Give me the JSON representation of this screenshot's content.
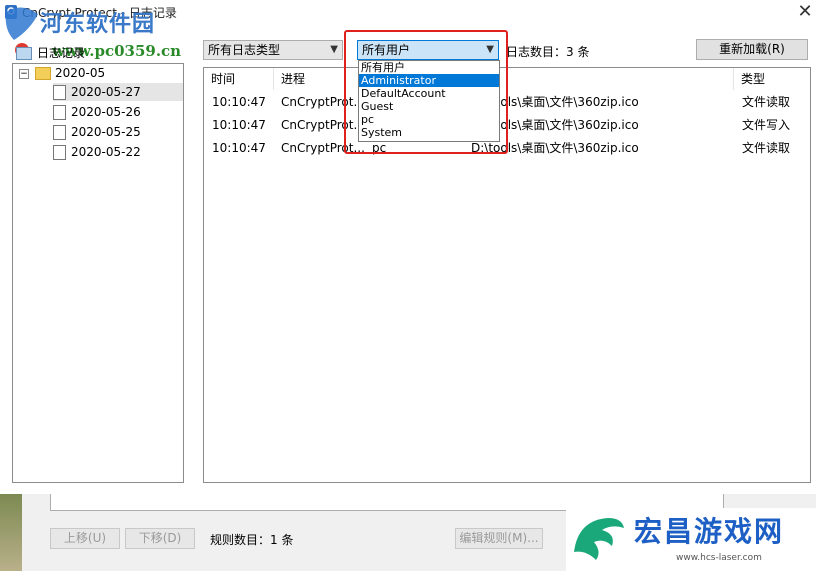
{
  "window": {
    "title": "CnCrypt Protect - 日志记录",
    "close_glyph": "✕"
  },
  "watermark_top": {
    "name": "河东软件园",
    "url": "www.pc0359.cn"
  },
  "tree": {
    "root_label": "日志记录",
    "folder_label": "2020-05",
    "expander": "−",
    "dates": [
      "2020-05-27",
      "2020-05-26",
      "2020-05-25",
      "2020-05-22"
    ],
    "selected_index": 0
  },
  "filters": {
    "log_type_value": "所有日志类型",
    "user_value": "所有用户",
    "count_label": "日志数目：3 条",
    "reload_label": "重新加载(R)"
  },
  "user_dropdown": {
    "options": [
      "所有用户",
      "Administrator",
      "DefaultAccount",
      "Guest",
      "pc",
      "System"
    ],
    "highlighted_index": 1
  },
  "list": {
    "columns": [
      "时间",
      "进程",
      "",
      "",
      "类型"
    ],
    "rows": [
      {
        "time": "10:10:47",
        "process": "CnCryptProt...",
        "user": "",
        "path": "D:\\tools\\桌面\\文件\\360zip.ico",
        "type": "文件读取"
      },
      {
        "time": "10:10:47",
        "process": "CnCryptProt...",
        "user": "",
        "path": "D:\\tools\\桌面\\文件\\360zip.ico",
        "type": "文件写入"
      },
      {
        "time": "10:10:47",
        "process": "CnCryptProt...",
        "user": "pc",
        "path": "D:\\tools\\桌面\\文件\\360zip.ico",
        "type": "文件读取"
      }
    ]
  },
  "bottom_window": {
    "up_label": "上移(U)",
    "down_label": "下移(D)",
    "rule_count": "规则数目：1 条",
    "edit_label": "编辑规则(M)..."
  },
  "watermark_bottom": {
    "name": "宏昌游戏网",
    "url": "www.hcs-laser.com"
  },
  "colors": {
    "highlight_red": "#e0201c",
    "selection_blue": "#0078d7"
  }
}
